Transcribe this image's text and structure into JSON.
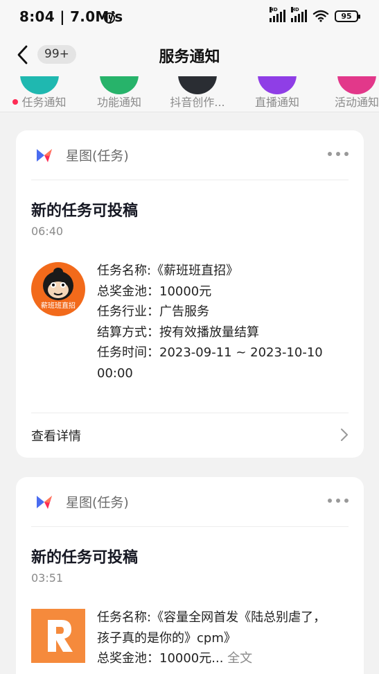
{
  "status_bar": {
    "time_speed": "8:04 | 7.0M/s",
    "signal_1_label": "HD",
    "signal_2_label": "HD",
    "battery": "95"
  },
  "nav": {
    "unread_badge": "99+",
    "title": "服务通知"
  },
  "categories": [
    {
      "label": "任务通知",
      "color": "#1fb8b0",
      "has_dot": true
    },
    {
      "label": "功能通知",
      "color": "#27b36a"
    },
    {
      "label": "抖音创作...",
      "color": "#2a2d33"
    },
    {
      "label": "直播通知",
      "color": "#8f3ee6"
    },
    {
      "label": "活动通知",
      "color": "#e2388a"
    }
  ],
  "cards": [
    {
      "source": "星图(任务)",
      "title": "新的任务可投稿",
      "time": "06:40",
      "lines": [
        "任务名称:《薪班班直招》",
        "总奖金池：10000元",
        "任务行业：广告服务",
        "结算方式：按有效播放量结算",
        "任务时间：2023-09-11 ~ 2023-10-10 00:00"
      ],
      "thumb_text": "薪班班直招",
      "footer_label": "查看详情"
    },
    {
      "source": "星图(任务)",
      "title": "新的任务可投稿",
      "time": "03:51",
      "line_1": "任务名称:《容量全网首发《陆总别虐了，孩子真的是你的》cpm》",
      "line_2_main": "总奖金池：10000元...",
      "line_2_more": "全文"
    }
  ],
  "colors": {
    "background": "#f2f2f2",
    "card": "#ffffff",
    "accent_red": "#fe2c55",
    "secondary_text": "#8a8a8a"
  }
}
